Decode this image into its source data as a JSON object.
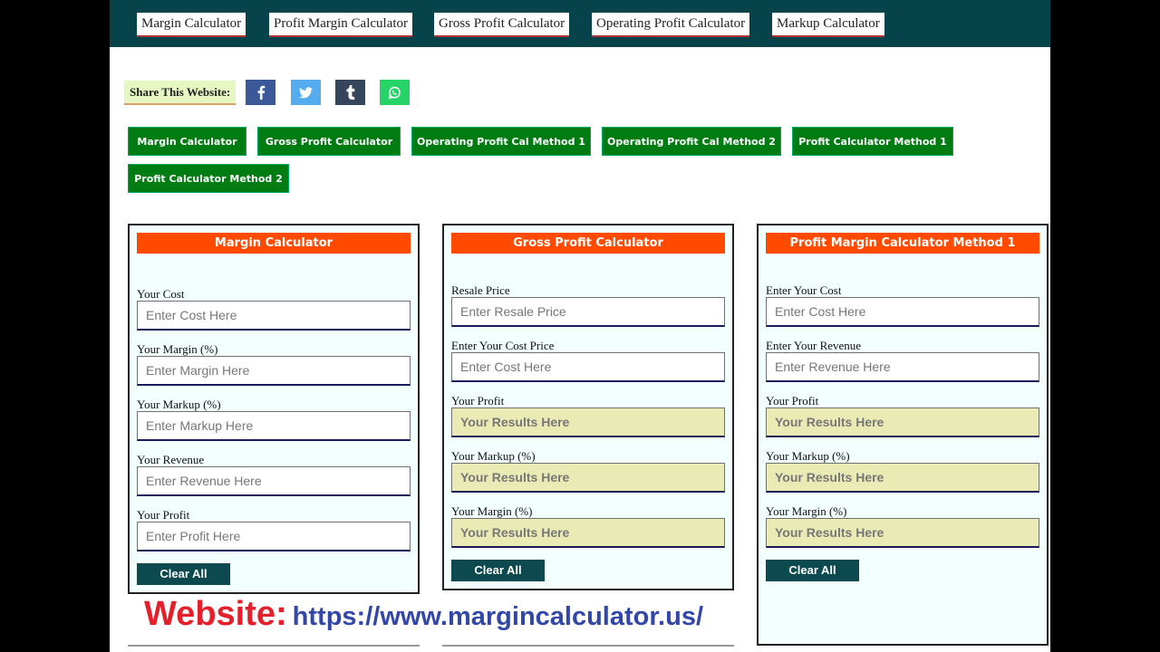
{
  "topnav": {
    "links": [
      {
        "label": "Margin Calculator"
      },
      {
        "label": "Profit Margin Calculator"
      },
      {
        "label": "Gross Profit Calculator"
      },
      {
        "label": "Operating Profit Calculator"
      },
      {
        "label": "Markup Calculator"
      }
    ]
  },
  "share": {
    "label": "Share This Website:",
    "buttons": [
      {
        "icon": "facebook-icon",
        "color": "#3b5998"
      },
      {
        "icon": "twitter-icon",
        "color": "#55acee"
      },
      {
        "icon": "tumblr-icon",
        "color": "#35465c"
      },
      {
        "icon": "whatsapp-icon",
        "color": "#25d366"
      }
    ]
  },
  "quicklinks": [
    {
      "label": "Margin Calculator"
    },
    {
      "label": "Gross Profit Calculator"
    },
    {
      "label": "Operating Profit Cal Method 1"
    },
    {
      "label": "Operating Profit Cal Method 2"
    },
    {
      "label": "Profit Calculator Method 1"
    },
    {
      "label": "Profit Calculator Method 2"
    }
  ],
  "calculators": [
    {
      "title": "Margin Calculator",
      "fields": [
        {
          "label": "Your Cost",
          "placeholder": "Enter Cost Here",
          "value": ""
        },
        {
          "label": "Your Margin (%)",
          "placeholder": "Enter Margin Here",
          "value": ""
        },
        {
          "label": "Your Markup (%)",
          "placeholder": "Enter Markup Here",
          "value": ""
        },
        {
          "label": "Your Revenue",
          "placeholder": "Enter Revenue Here",
          "value": ""
        },
        {
          "label": "Your Profit",
          "placeholder": "Enter Profit Here",
          "value": ""
        }
      ],
      "clear_label": "Clear All"
    },
    {
      "title": "Gross Profit Calculator",
      "fields": [
        {
          "label": "Resale Price",
          "placeholder": "Enter Resale Price",
          "value": ""
        },
        {
          "label": "Enter Your Cost Price",
          "placeholder": "Enter Cost Here",
          "value": ""
        },
        {
          "label": "Your Profit",
          "placeholder": "Your Results Here",
          "value": ""
        },
        {
          "label": "Your Markup (%)",
          "placeholder": "Your Results Here",
          "value": ""
        },
        {
          "label": "Your Margin (%)",
          "placeholder": "Your Results Here",
          "value": ""
        }
      ],
      "clear_label": "Clear All"
    },
    {
      "title": "Profit Margin Calculator Method 1",
      "fields": [
        {
          "label": "Enter Your Cost",
          "placeholder": "Enter Cost Here",
          "value": ""
        },
        {
          "label": "Enter Your Revenue",
          "placeholder": "Enter Revenue Here",
          "value": ""
        },
        {
          "label": "Your Profit",
          "placeholder": "Your Results Here",
          "value": ""
        },
        {
          "label": "Your Markup (%)",
          "placeholder": "Your Results Here",
          "value": ""
        },
        {
          "label": "Your Margin (%)",
          "placeholder": "Your Results Here",
          "value": ""
        }
      ],
      "clear_label": "Clear All"
    }
  ],
  "banner": {
    "label": "Website:",
    "url": "https://www.margincalculator.us/"
  },
  "colors": {
    "nav_bg": "#06434a",
    "quicklink_green": "#007c12",
    "calc_header_orange": "#ff4a00",
    "clear_button": "#0c4a50",
    "result_field": "#eaeab5",
    "banner_label_red": "#e3202b",
    "banner_url_blue": "#3347a8"
  }
}
